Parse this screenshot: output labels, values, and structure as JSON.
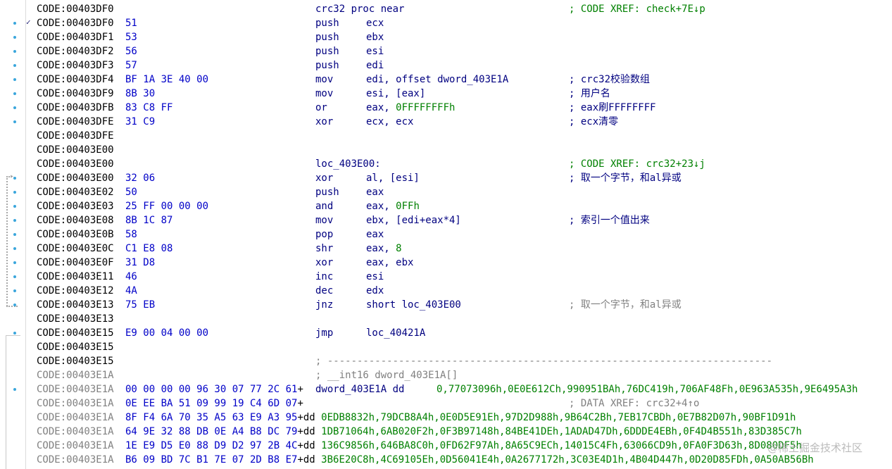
{
  "lines": [
    {
      "addr": "CODE:00403DF0",
      "bytes": "",
      "mnem": "crc32 proc near",
      "ops": "",
      "comment": "; CODE XREF: check+7E↓p",
      "ckind": "xref"
    },
    {
      "addr": "CODE:00403DF0",
      "bytes": "51",
      "mnem": "push",
      "ops": "ecx",
      "comment": ""
    },
    {
      "addr": "CODE:00403DF1",
      "bytes": "53",
      "mnem": "push",
      "ops": "ebx",
      "comment": ""
    },
    {
      "addr": "CODE:00403DF2",
      "bytes": "56",
      "mnem": "push",
      "ops": "esi",
      "comment": ""
    },
    {
      "addr": "CODE:00403DF3",
      "bytes": "57",
      "mnem": "push",
      "ops": "edi",
      "comment": ""
    },
    {
      "addr": "CODE:00403DF4",
      "bytes": "BF 1A 3E 40 00",
      "mnem": "mov",
      "ops": "edi, offset dword_403E1A",
      "comment": "; crc32校验数组"
    },
    {
      "addr": "CODE:00403DF9",
      "bytes": "8B 30",
      "mnem": "mov",
      "ops": "esi, [eax]",
      "comment": "; 用户名"
    },
    {
      "addr": "CODE:00403DFB",
      "bytes": "83 C8 FF",
      "mnem": "or",
      "ops": "eax, ",
      "num": "0FFFFFFFFh",
      "comment": "; eax刷FFFFFFFF"
    },
    {
      "addr": "CODE:00403DFE",
      "bytes": "31 C9",
      "mnem": "xor",
      "ops": "ecx, ecx",
      "comment": "; ecx清零"
    },
    {
      "addr": "CODE:00403DFE",
      "bytes": "",
      "mnem": "",
      "ops": "",
      "comment": ""
    },
    {
      "addr": "CODE:00403E00",
      "bytes": "",
      "mnem": "",
      "ops": "",
      "comment": ""
    },
    {
      "addr": "CODE:00403E00",
      "bytes": "",
      "mnem": "loc_403E00:",
      "ops": "",
      "comment": "; CODE XREF: crc32+23↓j",
      "ckind": "xref"
    },
    {
      "addr": "CODE:00403E00",
      "bytes": "32 06",
      "mnem": "xor",
      "ops": "al, [esi]",
      "comment": "; 取一个字节，和al异或"
    },
    {
      "addr": "CODE:00403E02",
      "bytes": "50",
      "mnem": "push",
      "ops": "eax",
      "comment": ""
    },
    {
      "addr": "CODE:00403E03",
      "bytes": "25 FF 00 00 00",
      "mnem": "and",
      "ops": "eax, ",
      "num": "0FFh",
      "comment": ""
    },
    {
      "addr": "CODE:00403E08",
      "bytes": "8B 1C 87",
      "mnem": "mov",
      "ops": "ebx, [edi+eax*4]",
      "comment": "; 索引一个值出来"
    },
    {
      "addr": "CODE:00403E0B",
      "bytes": "58",
      "mnem": "pop",
      "ops": "eax",
      "comment": ""
    },
    {
      "addr": "CODE:00403E0C",
      "bytes": "C1 E8 08",
      "mnem": "shr",
      "ops": "eax, ",
      "num": "8",
      "comment": ""
    },
    {
      "addr": "CODE:00403E0F",
      "bytes": "31 D8",
      "mnem": "xor",
      "ops": "eax, ebx",
      "comment": ""
    },
    {
      "addr": "CODE:00403E11",
      "bytes": "46",
      "mnem": "inc",
      "ops": "esi",
      "comment": ""
    },
    {
      "addr": "CODE:00403E12",
      "bytes": "4A",
      "mnem": "dec",
      "ops": "edx",
      "comment": ""
    },
    {
      "addr": "CODE:00403E13",
      "bytes": "75 EB",
      "mnem": "jnz",
      "ops": "short loc_403E00",
      "comment": "; 取一个字节，和al异或",
      "ckind": "gray"
    },
    {
      "addr": "CODE:00403E13",
      "bytes": "",
      "mnem": "",
      "ops": "",
      "comment": ""
    },
    {
      "addr": "CODE:00403E15",
      "bytes": "E9 00 04 00 00",
      "mnem": "jmp",
      "ops": "loc_40421A",
      "comment": ""
    },
    {
      "addr": "CODE:00403E15",
      "bytes": "",
      "mnem": "",
      "ops": "",
      "comment": ""
    },
    {
      "addr": "CODE:00403E15",
      "bytes": "",
      "mnem": "",
      "ops": "",
      "comment": "",
      "dash": "; ---------------------------------------------------------------------------"
    },
    {
      "addr": "CODE:00403E1A",
      "gray": true,
      "bytes": "",
      "mnem": "",
      "ops": "",
      "comment": "",
      "dash": "; __int16 dword_403E1A[]"
    },
    {
      "addr": "CODE:00403E1A",
      "gray": true,
      "bytes": "00 00 00 00 96 30 07 77 2C 61",
      "tail": "+",
      "dd": "dword_403E1A dd",
      "ddv": "0,77073096h,0E0E612Ch,990951BAh,76DC419h,706AF48Fh,0E963A535h,9E6495A3h"
    },
    {
      "addr": "CODE:00403E1A",
      "gray": true,
      "bytes": "0E EE BA 51 09 99 19 C4 6D 07",
      "tail": "+",
      "comment": "; DATA XREF: crc32+4↑o",
      "ckind": "xrefblue"
    },
    {
      "addr": "CODE:00403E1A",
      "gray": true,
      "bytes": "8F F4 6A 70 35 A5 63 E9 A3 95",
      "tail": "+dd ",
      "data": "0EDB8832h,79DCB8A4h,0E0D5E91Eh,97D2D988h,9B64C2Bh,7EB17CBDh,0E7B82D07h,90BF1D91h"
    },
    {
      "addr": "CODE:00403E1A",
      "gray": true,
      "bytes": "64 9E 32 88 DB 0E A4 B8 DC 79",
      "tail": "+dd ",
      "data": "1DB71064h,6AB020F2h,0F3B97148h,84BE41DEh,1ADAD47Dh,6DDDE4EBh,0F4D4B551h,83D385C7h"
    },
    {
      "addr": "CODE:00403E1A",
      "gray": true,
      "bytes": "1E E9 D5 E0 88 D9 D2 97 2B 4C",
      "tail": "+dd ",
      "data": "136C9856h,646BA8C0h,0FD62F97Ah,8A65C9ECh,14015C4Fh,63066CD9h,0FA0F3D63h,8D080DF5h"
    },
    {
      "addr": "CODE:00403E1A",
      "gray": true,
      "bytes": "B6 09 BD 7C B1 7E 07 2D B8 E7",
      "tail": "+dd ",
      "data": "3B6E20C8h,4C69105Eh,0D56041E4h,0A2677172h,3C03E4D1h,4B04D447h,0D20D85FDh,0A50AB56Bh"
    }
  ],
  "watermark": "@稀土掘金技术社区",
  "colors": {
    "addr": "#000000",
    "bytes": "#0000c8",
    "code": "#000080",
    "number": "#008000",
    "xref": "#008000",
    "muted": "#808080",
    "dot": "#3aa6dc"
  }
}
